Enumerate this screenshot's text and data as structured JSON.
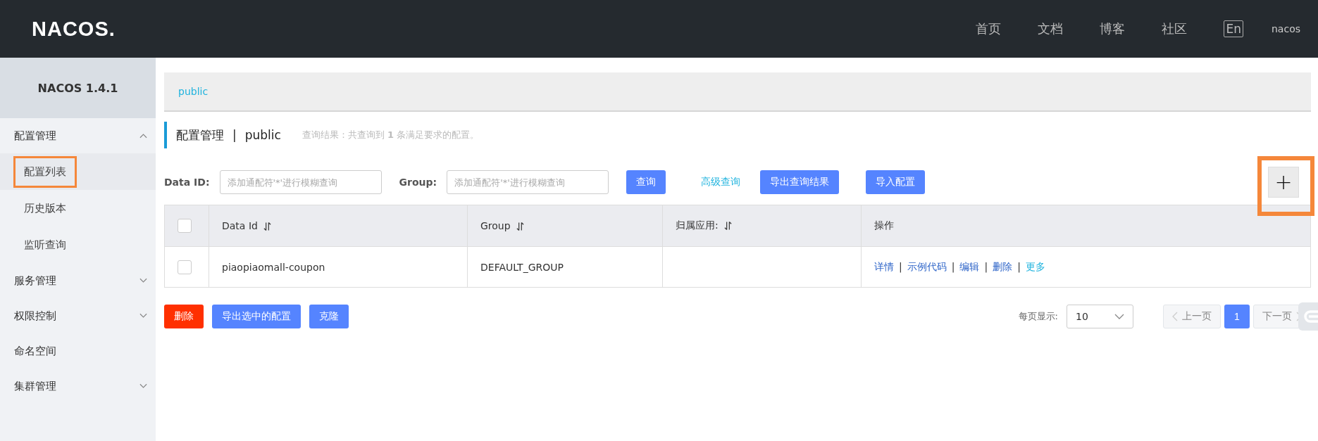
{
  "header": {
    "logo": "NACOS.",
    "nav": [
      {
        "label": "首页"
      },
      {
        "label": "文档"
      },
      {
        "label": "博客"
      },
      {
        "label": "社区"
      }
    ],
    "language": "En",
    "user": "nacos"
  },
  "sidebar": {
    "title": "NACOS 1.4.1",
    "items": [
      {
        "label": "配置管理",
        "expanded": true,
        "children": [
          {
            "label": "配置列表",
            "selected": true,
            "highlighted": true
          },
          {
            "label": "历史版本",
            "selected": false,
            "highlighted": false
          },
          {
            "label": "监听查询",
            "selected": false,
            "highlighted": false
          }
        ]
      },
      {
        "label": "服务管理",
        "expanded": false
      },
      {
        "label": "权限控制",
        "expanded": false
      },
      {
        "label": "命名空间"
      },
      {
        "label": "集群管理",
        "expanded": false
      }
    ]
  },
  "breadcrumb": "public",
  "page_title": {
    "title": "配置管理",
    "separator": "|",
    "namespace": "public",
    "result": "查询结果：共查询到 **1** 条满足要求的配置。"
  },
  "filters": [
    {
      "label": "Data ID:",
      "placeholder": "添加通配符'*'进行模糊查询"
    },
    {
      "label": "Group:",
      "placeholder": "添加通配符'*'进行模糊查询"
    }
  ],
  "toolbar": {
    "search_button": "查询",
    "advanced_link": "高级查询",
    "export_button": "导出查询结果",
    "import_button": "导入配置",
    "add_button": {
      "label": "+",
      "highlighted": true
    }
  },
  "table": {
    "header_checked": false,
    "columns": [
      {
        "label": "Data Id",
        "sortable": true
      },
      {
        "label": "Group",
        "sortable": true
      },
      {
        "label": "归属应用:",
        "sortable": true
      },
      {
        "label": "操作",
        "sortable": false
      }
    ],
    "rows": [
      {
        "checked": false,
        "data_id": "piaopiaomall-coupon",
        "group": "DEFAULT_GROUP",
        "actions": [
          {
            "label": "详情",
            "kind": "link"
          },
          {
            "label": "|",
            "kind": "separator"
          },
          {
            "label": "示例代码",
            "kind": "link"
          },
          {
            "label": "|",
            "kind": "separator"
          },
          {
            "label": "编辑",
            "kind": "link"
          },
          {
            "label": "|",
            "kind": "separator"
          },
          {
            "label": "删除",
            "kind": "link"
          },
          {
            "label": "|",
            "kind": "separator"
          },
          {
            "label": "更多",
            "kind": "more"
          }
        ]
      }
    ]
  },
  "bulk_buttons": [
    {
      "label": "删除",
      "kind": "danger"
    },
    {
      "label": "导出选中的配置",
      "kind": "primary"
    },
    {
      "label": "克隆",
      "kind": "primary"
    }
  ],
  "pagination": {
    "page_size_label": "每页显示:",
    "page_size": "10",
    "prev": "上一页",
    "pages": [
      {
        "label": "1",
        "selected": true
      }
    ],
    "next": "下一页"
  }
}
